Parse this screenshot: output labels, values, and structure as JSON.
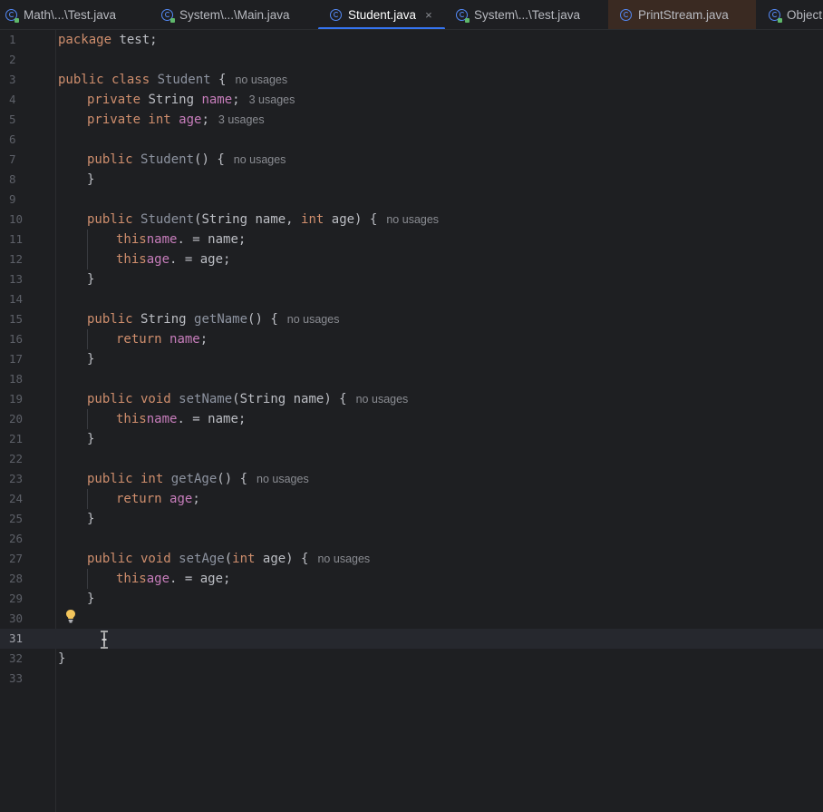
{
  "tabs": [
    {
      "label": "Math\\...\\Test.java",
      "icon": "java-class-run-icon"
    },
    {
      "label": "System\\...\\Main.java",
      "icon": "java-class-run-icon"
    },
    {
      "label": "Student.java",
      "icon": "java-class-icon",
      "active": true,
      "close": "×"
    },
    {
      "label": "System\\...\\Test.java",
      "icon": "java-class-run-icon"
    },
    {
      "label": "PrintStream.java",
      "icon": "java-class-icon"
    },
    {
      "label": "Object",
      "icon": "java-class-run-icon"
    }
  ],
  "editor": {
    "current_line": "31",
    "lines": [
      {
        "n": "1",
        "t1": "package",
        "t2": " test;"
      },
      {
        "n": "2"
      },
      {
        "n": "3",
        "k1": "public class ",
        "c1": "Student",
        "p1": " {",
        "hint": "no usages"
      },
      {
        "n": "4",
        "k1": "private ",
        "p0": "String ",
        "f1": "name",
        "p1": ";",
        "hint": "3 usages"
      },
      {
        "n": "5",
        "k1": "private int ",
        "f1": "age",
        "p1": ";",
        "hint": "3 usages"
      },
      {
        "n": "6"
      },
      {
        "n": "7",
        "k1": "public ",
        "c1": "Student",
        "p1": "() {",
        "hint": "no usages"
      },
      {
        "n": "8",
        "p1": "}"
      },
      {
        "n": "9"
      },
      {
        "n": "10",
        "k1": "public ",
        "c1": "Student",
        "p1": "(String name, ",
        "k2": "int",
        "p2": " age) {",
        "hint": "no usages"
      },
      {
        "n": "11",
        "k1": "this",
        "p1": ".",
        "f1": "name",
        "p2": " = name;"
      },
      {
        "n": "12",
        "k1": "this",
        "p1": ".",
        "f1": "age",
        "p2": " = age;"
      },
      {
        "n": "13",
        "p1": "}"
      },
      {
        "n": "14"
      },
      {
        "n": "15",
        "k1": "public ",
        "p0": "String ",
        "c1": "getName",
        "p1": "() {",
        "hint": "no usages"
      },
      {
        "n": "16",
        "k1": "return ",
        "f1": "name",
        "p1": ";"
      },
      {
        "n": "17",
        "p1": "}"
      },
      {
        "n": "18"
      },
      {
        "n": "19",
        "k1": "public void ",
        "c1": "setName",
        "p1": "(String name) {",
        "hint": "no usages"
      },
      {
        "n": "20",
        "k1": "this",
        "p1": ".",
        "f1": "name",
        "p2": " = name;"
      },
      {
        "n": "21",
        "p1": "}"
      },
      {
        "n": "22"
      },
      {
        "n": "23",
        "k1": "public int ",
        "c1": "getAge",
        "p1": "() {",
        "hint": "no usages"
      },
      {
        "n": "24",
        "k1": "return ",
        "f1": "age",
        "p1": ";"
      },
      {
        "n": "25",
        "p1": "}"
      },
      {
        "n": "26"
      },
      {
        "n": "27",
        "k1": "public void ",
        "c1": "setAge",
        "p1": "(",
        "k2": "int",
        "p2": " age) {",
        "hint": "no usages"
      },
      {
        "n": "28",
        "k1": "this",
        "p1": ".",
        "f1": "age",
        "p2": " = age;"
      },
      {
        "n": "29",
        "p1": "}"
      },
      {
        "n": "30"
      },
      {
        "n": "31"
      },
      {
        "n": "32",
        "p1": "}"
      },
      {
        "n": "33"
      }
    ]
  },
  "colors": {
    "background": "#1e1f22",
    "keyword": "#cf8e6d",
    "field": "#c77dbb",
    "accent": "#3574f0"
  }
}
